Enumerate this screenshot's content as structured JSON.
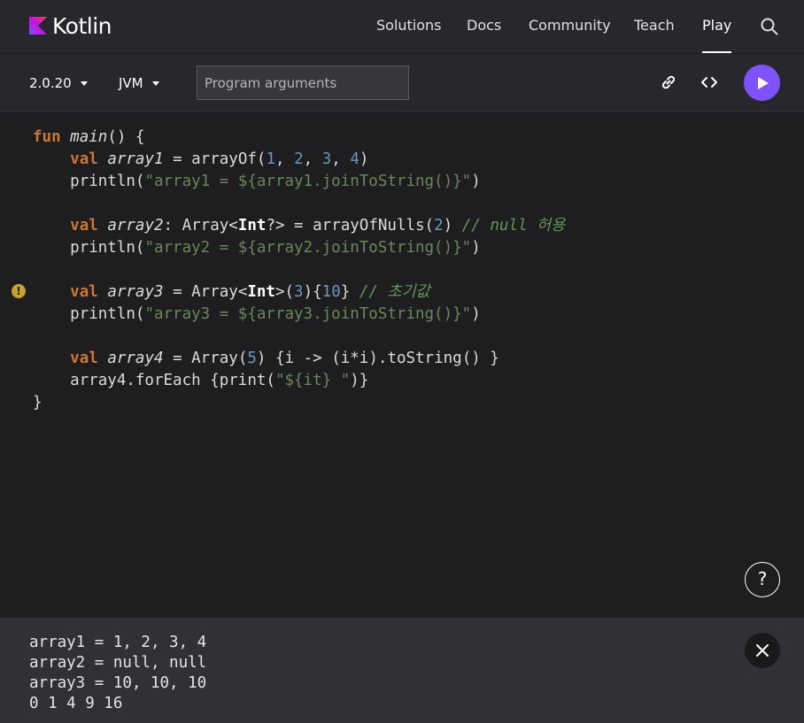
{
  "brand": {
    "name": "Kotlin",
    "accent": "#7f52ff"
  },
  "nav": {
    "items": [
      {
        "label": "Solutions"
      },
      {
        "label": "Docs"
      },
      {
        "label": "Community"
      },
      {
        "label": "Teach"
      },
      {
        "label": "Play",
        "active": true
      }
    ],
    "search_icon": "search-icon"
  },
  "toolbar": {
    "version": "2.0.20",
    "target": "JVM",
    "args_placeholder": "Program arguments",
    "args_value": "",
    "icons": [
      "link-icon",
      "embed-code-icon",
      "play-icon"
    ]
  },
  "editor": {
    "lines": [
      "fun main() {",
      "    val array1 = arrayOf(1, 2, 3, 4)",
      "    println(\"array1 = ${array1.joinToString()}\")",
      "",
      "    val array2: Array<Int?> = arrayOfNulls(2) // null 허용",
      "    println(\"array2 = ${array2.joinToString()}\")",
      "",
      "    val array3 = Array<Int>(3){10} // 초기값",
      "    println(\"array3 = ${array3.joinToString()}\")",
      "",
      "    val array4 = Array(5) {i -> (i*i).toString() }",
      "    array4.forEach {print(\"${it} \")}",
      "}"
    ],
    "warning_icon": "!",
    "help_label": "?"
  },
  "output": {
    "lines": [
      "array1 = 1, 2, 3, 4",
      "array2 = null, null",
      "array3 = 10, 10, 10",
      "0 1 4 9 16"
    ]
  },
  "colors": {
    "keyword": "#cc7832",
    "number": "#6897bb",
    "string": "#6a8759",
    "comment": "#629755",
    "warning": "#c9a227"
  }
}
